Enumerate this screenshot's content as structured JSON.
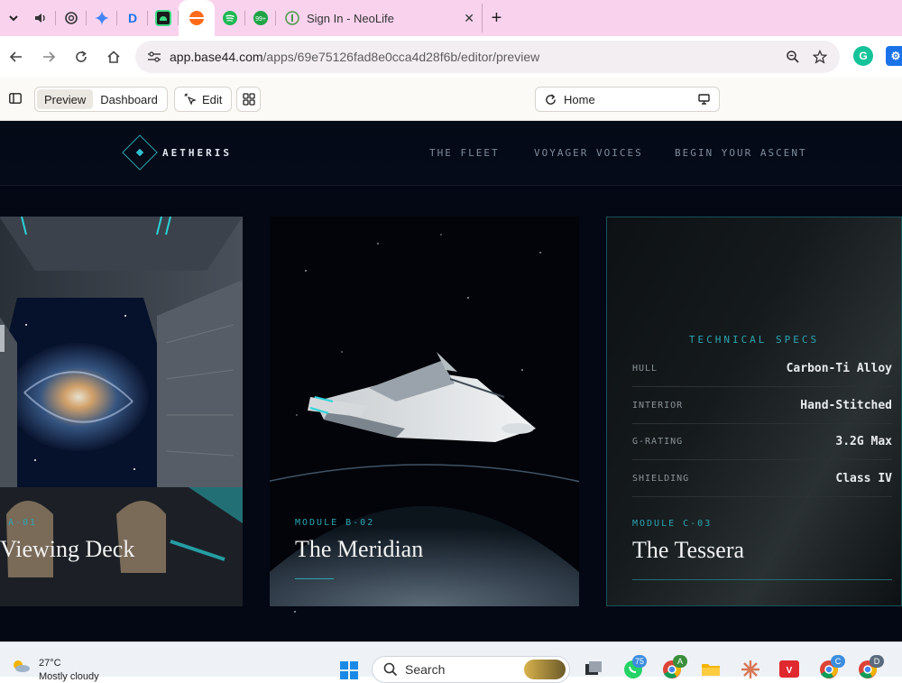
{
  "browser": {
    "tabs": {
      "active_title": "Sign In - NeoLife",
      "close_glyph": "✕",
      "new_tab_glyph": "+"
    },
    "address": {
      "url_host": "app.base44.com",
      "url_path": "/apps/69e75126fad8e0cca4d28f6b/editor/preview"
    }
  },
  "editor": {
    "modes": [
      "Preview",
      "Dashboard"
    ],
    "active_mode": "Preview",
    "edit_label": "Edit",
    "page_selector_value": "Home"
  },
  "site": {
    "brand": "AETHERIS",
    "nav": [
      "THE FLEET",
      "VOYAGER VOICES",
      "BEGIN YOUR ASCENT"
    ],
    "cards": [
      {
        "label": "A-01",
        "title": "Viewing Deck"
      },
      {
        "label": "MODULE B-02",
        "title": "The Meridian"
      },
      {
        "label": "MODULE C-03",
        "title": "The Tessera"
      }
    ],
    "specs": {
      "title": "TECHNICAL SPECS",
      "rows": [
        {
          "key": "HULL",
          "value": "Carbon-Ti Alloy"
        },
        {
          "key": "INTERIOR",
          "value": "Hand-Stitched"
        },
        {
          "key": "G-RATING",
          "value": "3.2G Max"
        },
        {
          "key": "SHIELDING",
          "value": "Class IV"
        }
      ]
    },
    "colors": {
      "accent": "#2aa6b3",
      "background": "#030814"
    }
  },
  "taskbar": {
    "weather_temp": "27°C",
    "weather_desc": "Mostly cloudy",
    "search_label": "Search",
    "whatsapp_badge": "75",
    "chrome_badges": [
      "A",
      "C",
      "D"
    ]
  }
}
